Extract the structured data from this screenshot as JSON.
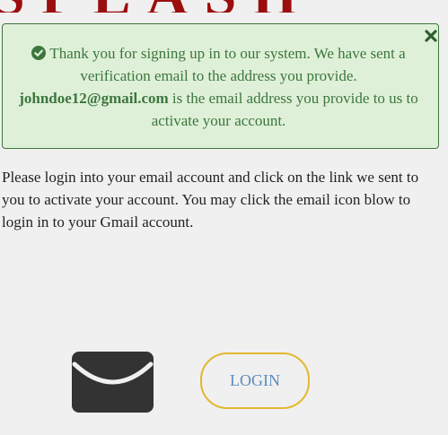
{
  "header": {
    "logo_text": "SPLASH"
  },
  "alert": {
    "message_part1": "Thank you for signing up in to our system. We have sent a verification email to the address you provide.",
    "email": "johndoe12@gmail.com",
    "message_part2": "is the email address you provide to us to activate your account.",
    "close_icon": "close-icon",
    "status_icon": "check-circle-icon",
    "color": "#3c763d",
    "background": "#dff0d8"
  },
  "instructions": {
    "text": "Please login into your email account and click on the link we sent to you to activate your account. You may click the email icon blow to login in to your Gmail account."
  },
  "actions": {
    "mail_icon": "envelope-icon",
    "login_label": "LOGIN",
    "login_border_color": "#e4b730",
    "login_text_color": "#5d8dbe"
  }
}
